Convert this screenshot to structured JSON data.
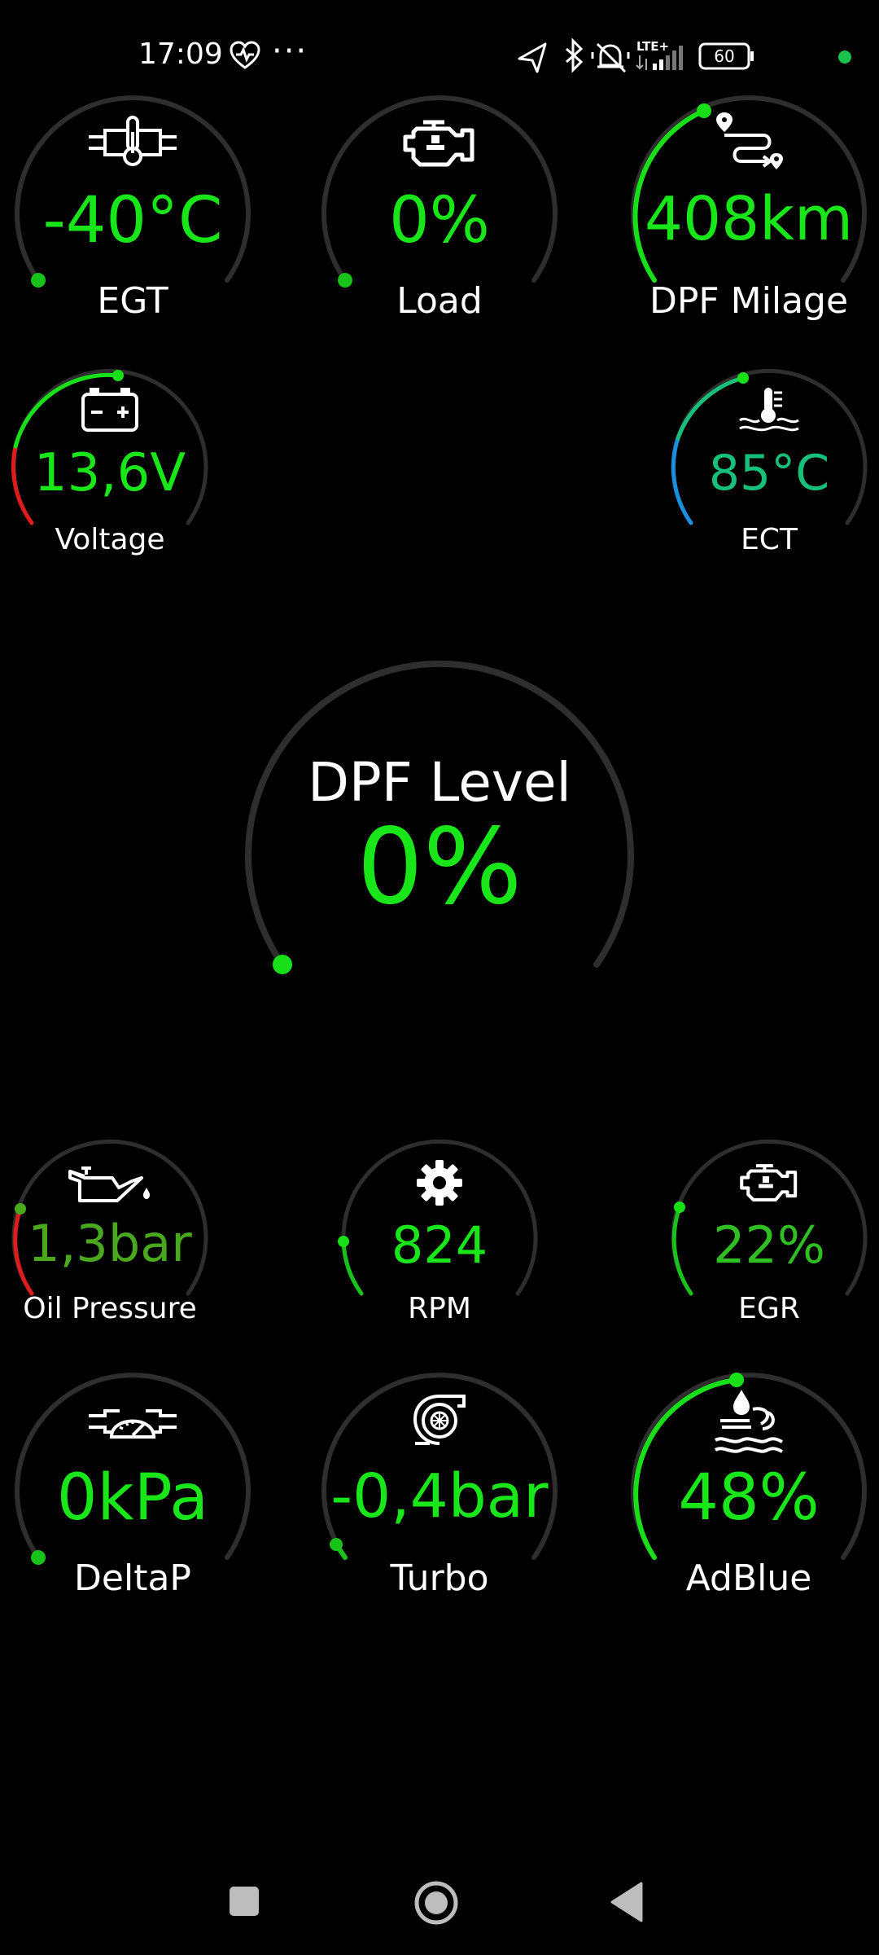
{
  "status_bar": {
    "time": "17:09",
    "more": "···",
    "network": "LTE+",
    "battery": "60",
    "dot_color": "#19c24a"
  },
  "colors": {
    "value_green": "#19e619",
    "arc_track": "#2e2e2e",
    "arc_green": "#18e018",
    "arc_red": "#e01b1b",
    "arc_blue": "#1a8fe0",
    "arc_teal": "#17c07a",
    "oil_value": "#4aa81e"
  },
  "gauges": {
    "egt": {
      "value": "-40°C",
      "label": "EGT",
      "icon": "exhaust-temperature-icon"
    },
    "load": {
      "value": "0%",
      "label": "Load",
      "icon": "engine-icon"
    },
    "dpf_milage": {
      "value": "408km",
      "label": "DPF Milage",
      "icon": "route-icon"
    },
    "voltage": {
      "value": "13,6V",
      "label": "Voltage",
      "icon": "battery-icon"
    },
    "ect": {
      "value": "85°C",
      "label": "ECT",
      "icon": "coolant-temperature-icon"
    },
    "dpf_level": {
      "value": "0%",
      "label": "DPF Level"
    },
    "oil_pressure": {
      "value": "1,3bar",
      "label": "Oil Pressure",
      "icon": "oil-can-icon"
    },
    "rpm": {
      "value": "824",
      "label": "RPM",
      "icon": "gear-icon"
    },
    "egr": {
      "value": "22%",
      "label": "EGR",
      "icon": "engine-icon"
    },
    "deltap": {
      "value": "0kPa",
      "label": "DeltaP",
      "icon": "pressure-gauge-icon"
    },
    "turbo": {
      "value": "-0,4bar",
      "label": "Turbo",
      "icon": "turbo-icon"
    },
    "adblue": {
      "value": "48%",
      "label": "AdBlue",
      "icon": "adblue-icon"
    }
  },
  "nav": {
    "recents": "recents",
    "home": "home",
    "back": "back"
  }
}
